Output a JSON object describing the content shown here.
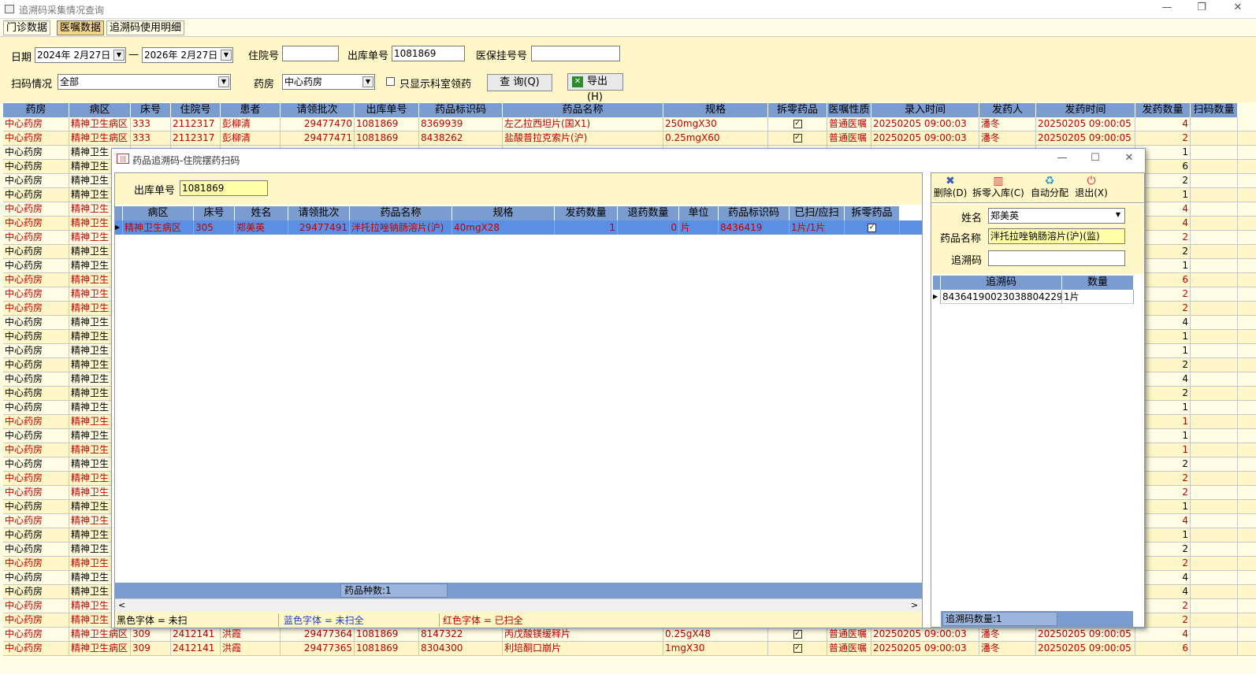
{
  "window": {
    "title": "追溯码采集情况查询"
  },
  "tabs": [
    "门诊数据",
    "医嘱数据",
    "追溯码使用明细"
  ],
  "filter": {
    "date_label": "日期",
    "date_from": "2024年  2月27日",
    "date_sep": "—",
    "date_to": "2026年  2月27日",
    "inpatient_no_label": "住院号",
    "inpatient_no": "",
    "out_no_label": "出库单号",
    "out_no": "1081869",
    "insurance_label": "医保挂号号",
    "insurance_no": "",
    "scan_label": "扫码情况",
    "scan_value": "全部",
    "pharmacy_label": "药房",
    "pharmacy_value": "中心药房",
    "only_dept_label": "只显示科室领药",
    "query_button": "查 询(Q)",
    "export_button": "导出(H)"
  },
  "grid": {
    "columns": [
      "药房",
      "病区",
      "床号",
      "住院号",
      "患者",
      "请领批次",
      "出库单号",
      "药品标识码",
      "药品名称",
      "规格",
      "拆零药品",
      "医嘱性质",
      "录入时间",
      "发药人",
      "发药时间",
      "发药数量",
      "扫码数量"
    ],
    "rows": [
      {
        "c": "red",
        "v": [
          "中心药房",
          "精神卫生病区",
          "333",
          "2112317",
          "彭柳清",
          "29477470",
          "1081869",
          "8369939",
          "左乙拉西坦片(国X1)",
          "250mgX30",
          "✓",
          "普通医嘱",
          "20250205 09:00:03",
          "潘冬",
          "20250205 09:00:05",
          "4",
          ""
        ]
      },
      {
        "c": "red",
        "v": [
          "中心药房",
          "精神卫生病区",
          "333",
          "2112317",
          "彭柳清",
          "29477471",
          "1081869",
          "8438262",
          "盐酸普拉克索片(沪)",
          "0.25mgX60",
          "✓",
          "普通医嘱",
          "20250205 09:00:03",
          "潘冬",
          "20250205 09:00:05",
          "2",
          ""
        ]
      },
      {
        "c": "blk",
        "v": [
          "中心药房",
          "精神卫生",
          "",
          "",
          "",
          "",
          "",
          "",
          "",
          "",
          "",
          "",
          "",
          "",
          "",
          "1",
          ""
        ]
      },
      {
        "c": "blk",
        "v": [
          "中心药房",
          "精神卫生",
          "",
          "",
          "",
          "",
          "",
          "",
          "",
          "",
          "",
          "",
          "",
          "",
          "",
          "6",
          ""
        ]
      },
      {
        "c": "blk",
        "v": [
          "中心药房",
          "精神卫生",
          "",
          "",
          "",
          "",
          "",
          "",
          "",
          "",
          "",
          "",
          "",
          "",
          "",
          "2",
          ""
        ]
      },
      {
        "c": "blk",
        "v": [
          "中心药房",
          "精神卫生",
          "",
          "",
          "",
          "",
          "",
          "",
          "",
          "",
          "",
          "",
          "",
          "",
          "",
          "1",
          ""
        ]
      },
      {
        "c": "red",
        "v": [
          "中心药房",
          "精神卫生",
          "",
          "",
          "",
          "",
          "",
          "",
          "",
          "",
          "",
          "",
          "",
          "",
          "",
          "4",
          ""
        ]
      },
      {
        "c": "red",
        "v": [
          "中心药房",
          "精神卫生",
          "",
          "",
          "",
          "",
          "",
          "",
          "",
          "",
          "",
          "",
          "",
          "",
          "",
          "4",
          ""
        ]
      },
      {
        "c": "red",
        "v": [
          "中心药房",
          "精神卫生",
          "",
          "",
          "",
          "",
          "",
          "",
          "",
          "",
          "",
          "",
          "",
          "",
          "",
          "2",
          ""
        ]
      },
      {
        "c": "blk",
        "v": [
          "中心药房",
          "精神卫生",
          "",
          "",
          "",
          "",
          "",
          "",
          "",
          "",
          "",
          "",
          "",
          "",
          "",
          "2",
          ""
        ]
      },
      {
        "c": "blk",
        "v": [
          "中心药房",
          "精神卫生",
          "",
          "",
          "",
          "",
          "",
          "",
          "",
          "",
          "",
          "",
          "",
          "",
          "",
          "1",
          ""
        ]
      },
      {
        "c": "red",
        "v": [
          "中心药房",
          "精神卫生",
          "",
          "",
          "",
          "",
          "",
          "",
          "",
          "",
          "",
          "",
          "",
          "",
          "",
          "6",
          ""
        ]
      },
      {
        "c": "red",
        "v": [
          "中心药房",
          "精神卫生",
          "",
          "",
          "",
          "",
          "",
          "",
          "",
          "",
          "",
          "",
          "",
          "",
          "",
          "2",
          ""
        ]
      },
      {
        "c": "red",
        "v": [
          "中心药房",
          "精神卫生",
          "",
          "",
          "",
          "",
          "",
          "",
          "",
          "",
          "",
          "",
          "",
          "",
          "",
          "2",
          ""
        ]
      },
      {
        "c": "blk",
        "v": [
          "中心药房",
          "精神卫生",
          "",
          "",
          "",
          "",
          "",
          "",
          "",
          "",
          "",
          "",
          "",
          "",
          "",
          "4",
          ""
        ]
      },
      {
        "c": "blk",
        "v": [
          "中心药房",
          "精神卫生",
          "",
          "",
          "",
          "",
          "",
          "",
          "",
          "",
          "",
          "",
          "",
          "",
          "",
          "1",
          ""
        ]
      },
      {
        "c": "blk",
        "v": [
          "中心药房",
          "精神卫生",
          "",
          "",
          "",
          "",
          "",
          "",
          "",
          "",
          "",
          "",
          "",
          "",
          "",
          "1",
          ""
        ]
      },
      {
        "c": "blk",
        "v": [
          "中心药房",
          "精神卫生",
          "",
          "",
          "",
          "",
          "",
          "",
          "",
          "",
          "",
          "",
          "",
          "",
          "",
          "2",
          ""
        ]
      },
      {
        "c": "blk",
        "v": [
          "中心药房",
          "精神卫生",
          "",
          "",
          "",
          "",
          "",
          "",
          "",
          "",
          "",
          "",
          "",
          "",
          "",
          "4",
          ""
        ]
      },
      {
        "c": "blk",
        "v": [
          "中心药房",
          "精神卫生",
          "",
          "",
          "",
          "",
          "",
          "",
          "",
          "",
          "",
          "",
          "",
          "",
          "",
          "2",
          ""
        ]
      },
      {
        "c": "blk",
        "v": [
          "中心药房",
          "精神卫生",
          "",
          "",
          "",
          "",
          "",
          "",
          "",
          "",
          "",
          "",
          "",
          "",
          "",
          "1",
          ""
        ]
      },
      {
        "c": "red",
        "v": [
          "中心药房",
          "精神卫生",
          "",
          "",
          "",
          "",
          "",
          "",
          "",
          "",
          "",
          "",
          "",
          "",
          "",
          "1",
          ""
        ]
      },
      {
        "c": "blk",
        "v": [
          "中心药房",
          "精神卫生",
          "",
          "",
          "",
          "",
          "",
          "",
          "",
          "",
          "",
          "",
          "",
          "",
          "",
          "1",
          ""
        ]
      },
      {
        "c": "red",
        "v": [
          "中心药房",
          "精神卫生",
          "",
          "",
          "",
          "",
          "",
          "",
          "",
          "",
          "",
          "",
          "",
          "",
          "",
          "1",
          ""
        ]
      },
      {
        "c": "blk",
        "v": [
          "中心药房",
          "精神卫生",
          "",
          "",
          "",
          "",
          "",
          "",
          "",
          "",
          "",
          "",
          "",
          "",
          "",
          "2",
          ""
        ]
      },
      {
        "c": "red",
        "v": [
          "中心药房",
          "精神卫生",
          "",
          "",
          "",
          "",
          "",
          "",
          "",
          "",
          "",
          "",
          "",
          "",
          "",
          "2",
          ""
        ]
      },
      {
        "c": "red",
        "v": [
          "中心药房",
          "精神卫生",
          "",
          "",
          "",
          "",
          "",
          "",
          "",
          "",
          "",
          "",
          "",
          "",
          "",
          "2",
          ""
        ]
      },
      {
        "c": "blk",
        "v": [
          "中心药房",
          "精神卫生",
          "",
          "",
          "",
          "",
          "",
          "",
          "",
          "",
          "",
          "",
          "",
          "",
          "",
          "1",
          ""
        ]
      },
      {
        "c": "red",
        "v": [
          "中心药房",
          "精神卫生",
          "",
          "",
          "",
          "",
          "",
          "",
          "",
          "",
          "",
          "",
          "",
          "",
          "",
          "4",
          ""
        ]
      },
      {
        "c": "blk",
        "v": [
          "中心药房",
          "精神卫生",
          "",
          "",
          "",
          "",
          "",
          "",
          "",
          "",
          "",
          "",
          "",
          "",
          "",
          "1",
          ""
        ]
      },
      {
        "c": "blk",
        "v": [
          "中心药房",
          "精神卫生",
          "",
          "",
          "",
          "",
          "",
          "",
          "",
          "",
          "",
          "",
          "",
          "",
          "",
          "2",
          ""
        ]
      },
      {
        "c": "red",
        "v": [
          "中心药房",
          "精神卫生",
          "",
          "",
          "",
          "",
          "",
          "",
          "",
          "",
          "",
          "",
          "",
          "",
          "",
          "2",
          ""
        ]
      },
      {
        "c": "blk",
        "v": [
          "中心药房",
          "精神卫生",
          "",
          "",
          "",
          "",
          "",
          "",
          "",
          "",
          "",
          "",
          "",
          "",
          "",
          "4",
          ""
        ]
      },
      {
        "c": "blk",
        "v": [
          "中心药房",
          "精神卫生",
          "",
          "",
          "",
          "",
          "",
          "",
          "",
          "",
          "",
          "",
          "",
          "",
          "",
          "4",
          ""
        ]
      },
      {
        "c": "red",
        "v": [
          "中心药房",
          "精神卫生",
          "",
          "",
          "",
          "",
          "",
          "",
          "",
          "",
          "",
          "",
          "",
          "",
          "",
          "2",
          ""
        ]
      },
      {
        "c": "red",
        "v": [
          "中心药房",
          "精神卫生",
          "",
          "",
          "",
          "",
          "",
          "",
          "",
          "",
          "",
          "",
          "",
          "",
          "",
          "2",
          ""
        ]
      },
      {
        "c": "red",
        "v": [
          "中心药房",
          "精神卫生病区",
          "309",
          "2412141",
          "洪霞",
          "29477364",
          "1081869",
          "8147322",
          "丙戊酸镁缓释片",
          "0.25gX48",
          "✓",
          "普通医嘱",
          "20250205 09:00:03",
          "潘冬",
          "20250205 09:00:05",
          "4",
          ""
        ]
      },
      {
        "c": "red",
        "v": [
          "中心药房",
          "精神卫生病区",
          "309",
          "2412141",
          "洪霞",
          "29477365",
          "1081869",
          "8304300",
          "利培酮口崩片",
          "1mgX30",
          "✓",
          "普通医嘱",
          "20250205 09:00:03",
          "潘冬",
          "20250205 09:00:05",
          "6",
          ""
        ]
      }
    ]
  },
  "dialog": {
    "title": "药品追溯码-住院摆药扫码",
    "out_no_label": "出库单号",
    "out_no": "1081869",
    "columns": [
      "病区",
      "床号",
      "姓名",
      "请领批次",
      "药品名称",
      "规格",
      "发药数量",
      "退药数量",
      "单位",
      "药品标识码",
      "已扫/应扫",
      "拆零药品"
    ],
    "row": [
      "精神卫生病区",
      "305",
      "郑美英",
      "29477491",
      "泮托拉唑钠肠溶片(沪)",
      "40mgX28",
      "1",
      "0",
      "片",
      "8436419",
      "1片/1片",
      "✓"
    ],
    "kinds_label": "药品种数:1",
    "legend": [
      "黑色字体 = 未扫",
      "蓝色字体 = 未扫全",
      "红色字体 = 已扫全"
    ],
    "tools": [
      "删除(D)",
      "拆零入库(C)",
      "自动分配",
      "退出(X)"
    ],
    "name_label": "姓名",
    "name_value": "郑美英",
    "drug_label": "药品名称",
    "drug_value": "泮托拉唑钠肠溶片(沪)(监)",
    "trace_label": "追溯码",
    "trace_value": "",
    "trace_columns": [
      "追溯码",
      "数量"
    ],
    "trace_row": [
      "84364190023038804229",
      "1片"
    ],
    "trace_count": "追溯码数量:1"
  }
}
